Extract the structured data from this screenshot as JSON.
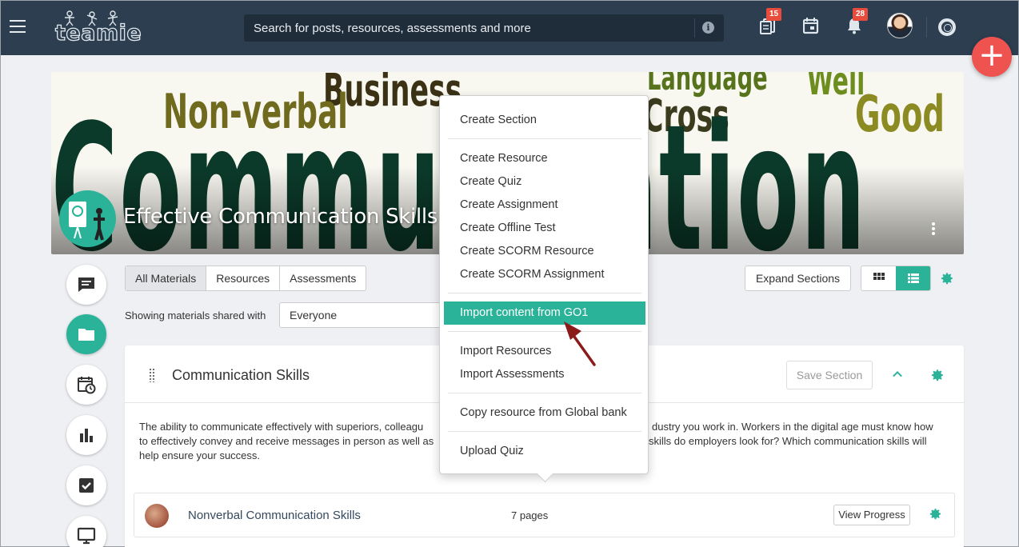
{
  "topbar": {
    "logo_text": "teamie",
    "search_placeholder": "Search for posts, resources, assessments and more",
    "badges": {
      "resources": "15",
      "notifications": "28"
    },
    "icons": [
      "menu-icon",
      "info-icon",
      "resources-icon",
      "calendar-icon",
      "bell-icon",
      "help-icon"
    ],
    "fab_label": "+"
  },
  "course": {
    "title": "Effective Communication Skills",
    "banner_words": [
      "Business",
      "Non-verbal",
      "Language",
      "Well",
      "Cross",
      "Good",
      "Communication"
    ]
  },
  "filters": {
    "tabs": [
      {
        "label": "All Materials",
        "active": true
      },
      {
        "label": "Resources",
        "active": false
      },
      {
        "label": "Assessments",
        "active": false
      }
    ],
    "shared_label": "Showing materials shared with",
    "shared_value": "Everyone",
    "expand_label": "Expand Sections"
  },
  "section": {
    "title": "Communication Skills",
    "save_label": "Save Section",
    "description": "The ability to communicate effectively with superiors, colleagues and staff is essential, no matter what industry you work in. Workers in the digital age must know how to effectively convey and receive messages in person as well as via phone, email and social media. What skills do employers look for? Which communication skills will help ensure your success.",
    "description_visible_1": "The ability to communicate effectively with superiors, colleagu",
    "description_visible_1b": "dustry you work in. Workers in the digital age must know how",
    "description_visible_2": "to effectively convey and receive messages in person as well as",
    "description_visible_2b": "skills do employers look for? Which communication skills will",
    "description_visible_3": "help ensure your success.",
    "items": [
      {
        "title": "Nonverbal Communication Skills",
        "pages": "7 pages",
        "action": "View Progress"
      }
    ]
  },
  "menu": {
    "groups": [
      [
        "Create Section"
      ],
      [
        "Create Resource",
        "Create Quiz",
        "Create Assignment",
        "Create Offline Test",
        "Create SCORM Resource",
        "Create SCORM Assignment"
      ],
      [
        "Import content from GO1"
      ],
      [
        "Import Resources",
        "Import Assessments"
      ],
      [
        "Copy resource from Global bank"
      ],
      [
        "Upload Quiz"
      ]
    ],
    "highlighted": "Import content from GO1"
  },
  "colors": {
    "topbar": "#2c3e50",
    "accent": "#2bb39a",
    "fab": "#ef5350",
    "badge": "#e74c3c",
    "arrow": "#8b1a1a"
  }
}
